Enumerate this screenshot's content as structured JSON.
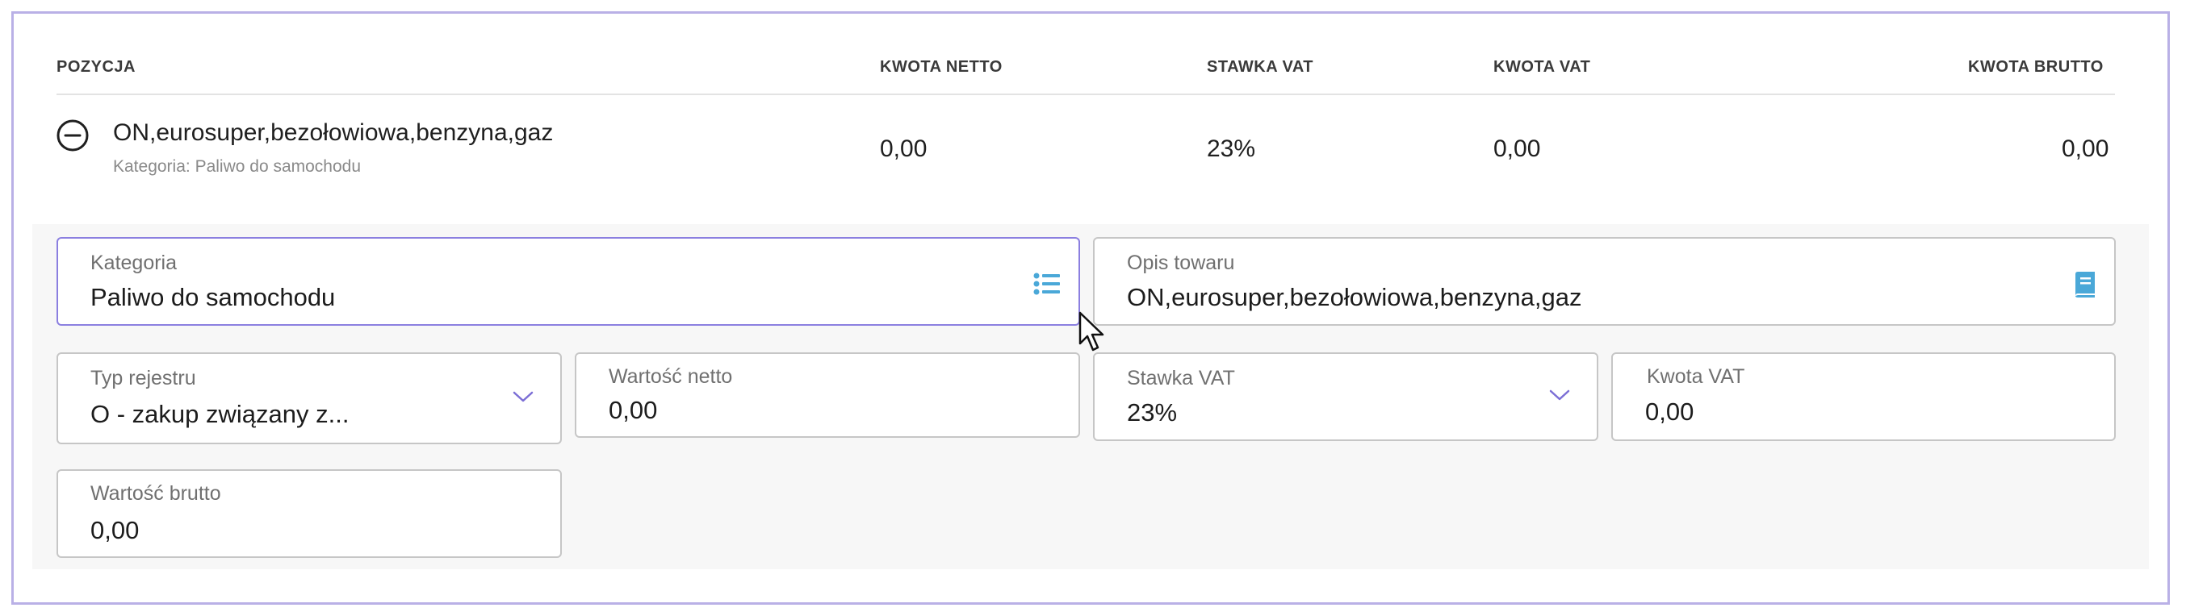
{
  "table": {
    "headers": {
      "pozycja": "POZYCJA",
      "netto": "KWOTA NETTO",
      "stawka": "STAWKA VAT",
      "vat": "KWOTA VAT",
      "brutto": "KWOTA BRUTTO"
    },
    "row": {
      "name": "ON,eurosuper,bezołowiowa,benzyna,gaz",
      "category": "Kategoria: Paliwo do samochodu",
      "netto": "0,00",
      "stawka": "23%",
      "vat": "0,00",
      "brutto": "0,00"
    }
  },
  "form": {
    "kategoria": {
      "label": "Kategoria",
      "value": "Paliwo do samochodu"
    },
    "opis": {
      "label": "Opis towaru",
      "value": "ON,eurosuper,bezołowiowa,benzyna,gaz"
    },
    "typ_rejestru": {
      "label": "Typ rejestru",
      "value": "O - zakup związany z..."
    },
    "wartosc_netto": {
      "label": "Wartość netto",
      "value": "0,00"
    },
    "stawka_vat": {
      "label": "Stawka VAT",
      "value": "23%"
    },
    "kwota_vat": {
      "label": "Kwota VAT",
      "value": "0,00"
    },
    "wartosc_brutto": {
      "label": "Wartość brutto",
      "value": "0,00"
    }
  },
  "icons": {
    "collapse": "minus-circle-icon",
    "list": "list-icon",
    "book": "book-icon",
    "dropdown": "chevron-down-icon",
    "pointer": "mouse-cursor-icon"
  },
  "colors": {
    "focus_border": "#8b7fe0",
    "icon_accent": "#4aa8d8",
    "chevron": "#7c6fd6",
    "frame": "#b9b0e6"
  }
}
